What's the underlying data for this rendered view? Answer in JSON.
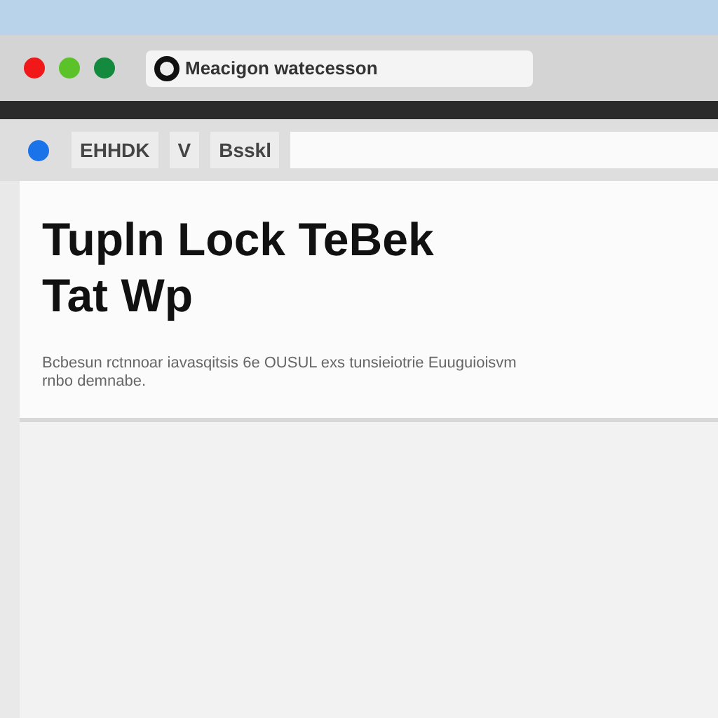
{
  "window": {
    "controls": [
      {
        "kind": "close"
      },
      {
        "kind": "minimize"
      },
      {
        "kind": "zoom"
      }
    ],
    "address": "Meacigon watecesson"
  },
  "toolbar": {
    "buttons": [
      "EHHDK",
      "V",
      "Bsskl"
    ]
  },
  "page": {
    "heading": "Tupln Lock TeBek Tat Wp",
    "paragraph": "Bcbesun rctnnoar iavasqitsis 6e OUSUL exs tunsieiotrie Euuguioisvm rnbo demnabe."
  }
}
